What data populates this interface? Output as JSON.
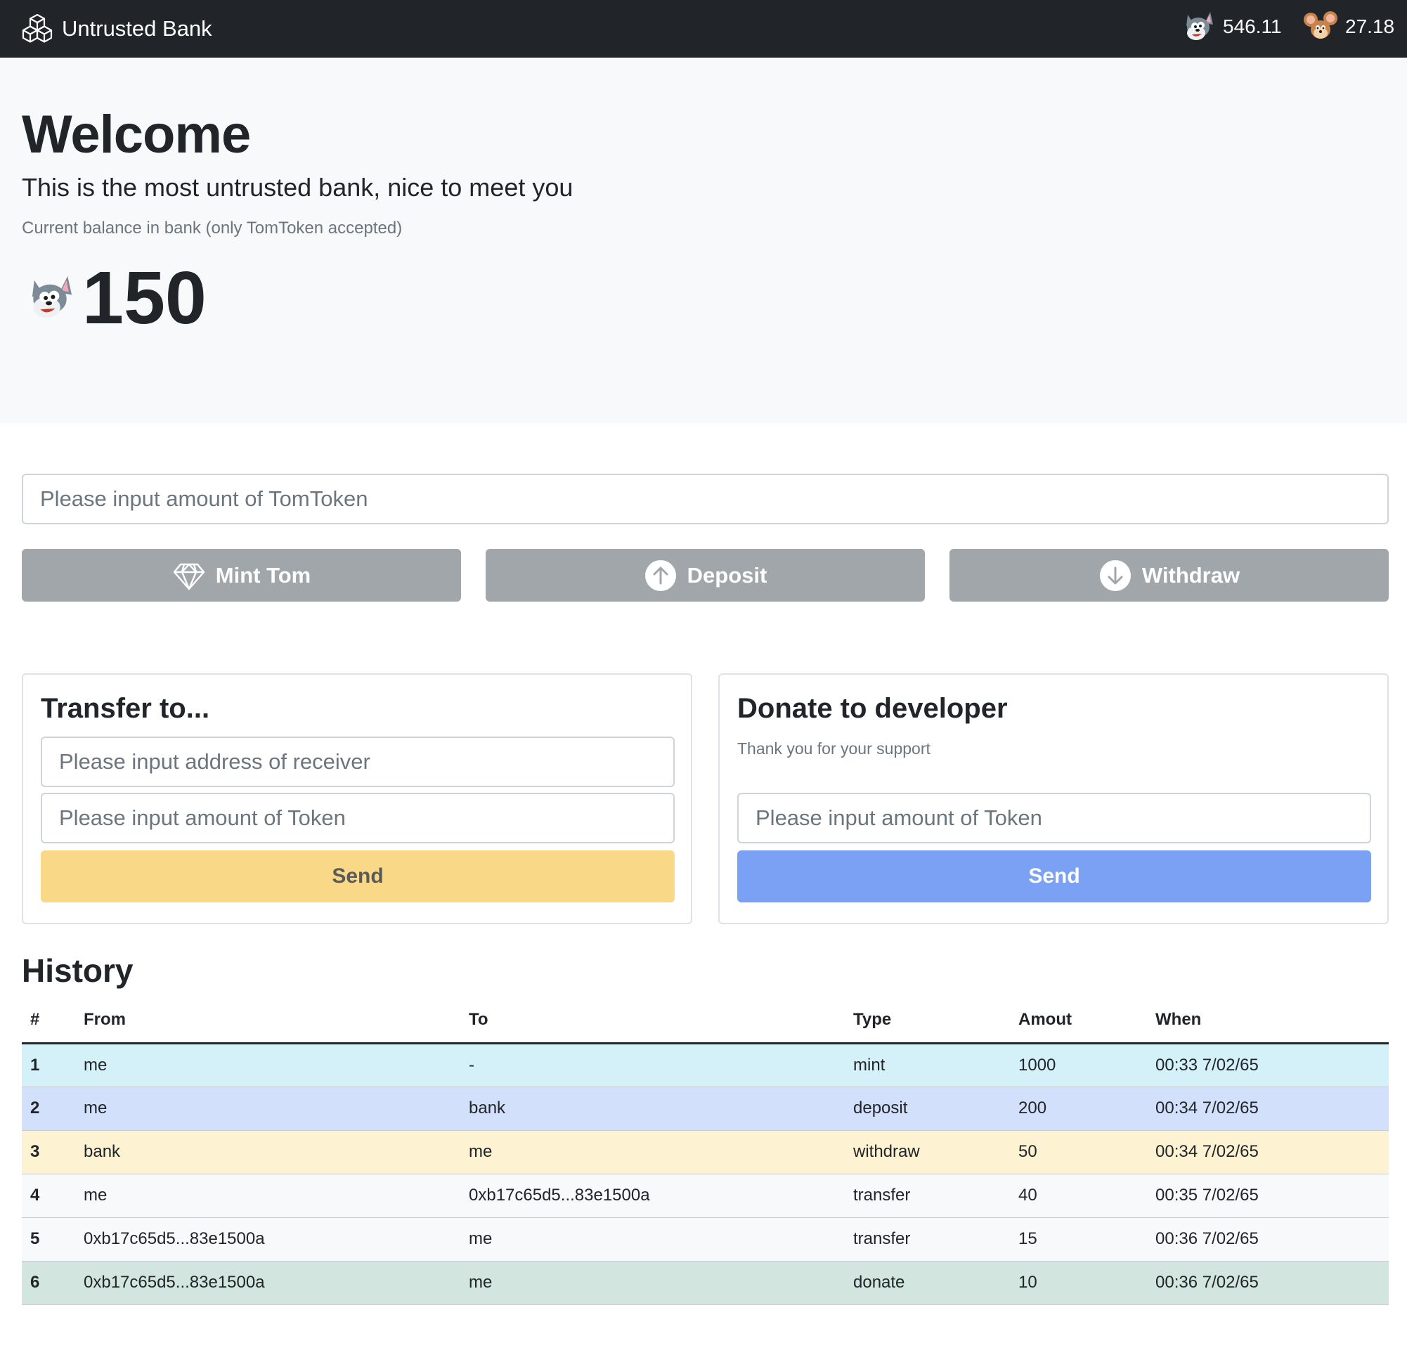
{
  "navbar": {
    "brand": "Untrusted Bank",
    "brand_icon": "boxes-icon",
    "tom_balance": "546.11",
    "jerry_balance": "27.18"
  },
  "hero": {
    "title": "Welcome",
    "lead": "This is the most untrusted bank, nice to meet you",
    "note": "Current balance in bank (only TomToken accepted)",
    "balance": "150"
  },
  "actions": {
    "amount_placeholder": "Please input amount of TomToken",
    "mint_label": "Mint Tom",
    "deposit_label": "Deposit",
    "withdraw_label": "Withdraw",
    "button_color": "#a1a6aa"
  },
  "transfer": {
    "title": "Transfer to...",
    "receiver_placeholder": "Please input address of receiver",
    "amount_placeholder": "Please input amount of Token",
    "send_label": "Send",
    "send_color": "#f9d987"
  },
  "donate": {
    "title": "Donate to developer",
    "subtitle": "Thank you for your support",
    "amount_placeholder": "Please input amount of Token",
    "send_label": "Send",
    "send_color": "#7ba1f5"
  },
  "history": {
    "title": "History",
    "columns": [
      "#",
      "From",
      "To",
      "Type",
      "Amout",
      "When"
    ],
    "rows": [
      {
        "num": "1",
        "from": "me",
        "to": "-",
        "type": "mint",
        "amount": "1000",
        "when": "00:33 7/02/65"
      },
      {
        "num": "2",
        "from": "me",
        "to": "bank",
        "type": "deposit",
        "amount": "200",
        "when": "00:34 7/02/65"
      },
      {
        "num": "3",
        "from": "bank",
        "to": "me",
        "type": "withdraw",
        "amount": "50",
        "when": "00:34 7/02/65"
      },
      {
        "num": "4",
        "from": "me",
        "to": "0xb17c65d5...83e1500a",
        "type": "transfer",
        "amount": "40",
        "when": "00:35 7/02/65"
      },
      {
        "num": "5",
        "from": "0xb17c65d5...83e1500a",
        "to": "me",
        "type": "transfer",
        "amount": "15",
        "when": "00:36 7/02/65"
      },
      {
        "num": "6",
        "from": "0xb17c65d5...83e1500a",
        "to": "me",
        "type": "donate",
        "amount": "10",
        "when": "00:36 7/02/65"
      }
    ]
  }
}
